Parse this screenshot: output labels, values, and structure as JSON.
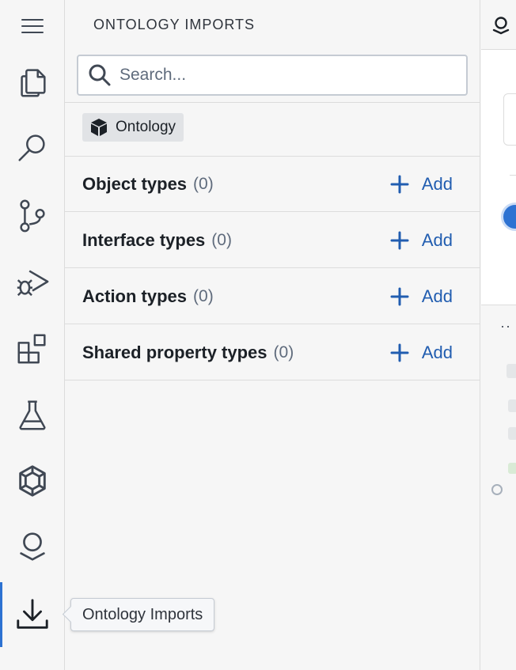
{
  "activity_bar": {
    "items": [
      {
        "icon": "hamburger-menu-icon"
      },
      {
        "icon": "files-icon"
      },
      {
        "icon": "search-icon"
      },
      {
        "icon": "git-branch-icon"
      },
      {
        "icon": "debug-run-icon"
      },
      {
        "icon": "extensions-icon"
      },
      {
        "icon": "flask-icon"
      },
      {
        "icon": "hexagon-ring-icon"
      },
      {
        "icon": "palantir-icon"
      },
      {
        "icon": "download-icon",
        "active": true
      }
    ],
    "active_color": "#2d72d2"
  },
  "panel": {
    "title": "ONTOLOGY IMPORTS",
    "search": {
      "placeholder": "Search...",
      "value": ""
    },
    "filter_tag": {
      "label": "Ontology",
      "icon": "cube-icon"
    },
    "rows": [
      {
        "label": "Object types",
        "count": "(0)",
        "action": "Add"
      },
      {
        "label": "Interface types",
        "count": "(0)",
        "action": "Add"
      },
      {
        "label": "Action types",
        "count": "(0)",
        "action": "Add"
      },
      {
        "label": "Shared property types",
        "count": "(0)",
        "action": "Add"
      }
    ],
    "accent_color": "#215db0"
  },
  "tooltip": {
    "text": "Ontology Imports"
  },
  "right_area": {
    "dots": "··"
  }
}
